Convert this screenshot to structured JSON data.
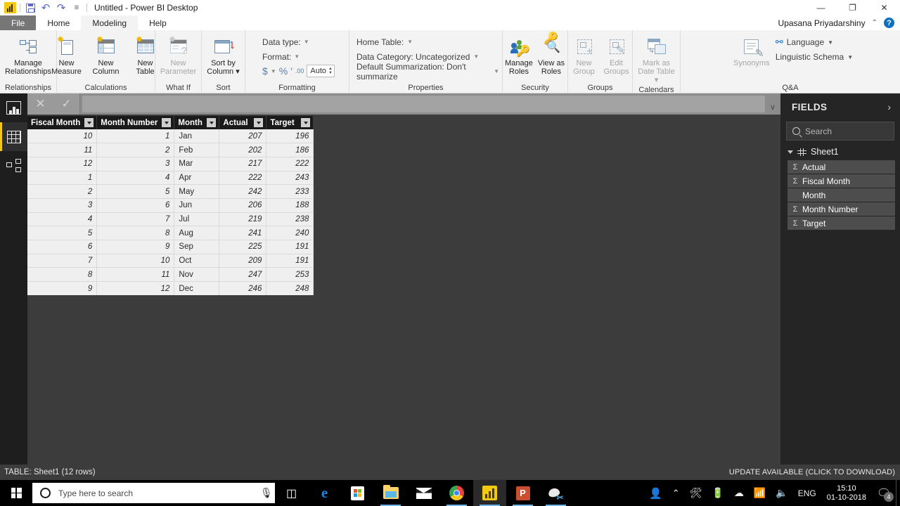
{
  "titlebar": {
    "app_icon": "power-bi-logo",
    "quick_access": [
      {
        "name": "save-icon",
        "label": "Save"
      },
      {
        "name": "undo-icon",
        "label": "↶"
      },
      {
        "name": "redo-icon",
        "label": "↷"
      },
      {
        "name": "customize-qat-icon",
        "label": "⨍"
      }
    ],
    "title": "Untitled - Power BI Desktop",
    "minimize": "—",
    "restore": "❐",
    "close": "✕"
  },
  "tabs": {
    "items": [
      {
        "label": "File",
        "kind": "file"
      },
      {
        "label": "Home",
        "kind": "normal"
      },
      {
        "label": "Modeling",
        "kind": "active"
      },
      {
        "label": "Help",
        "kind": "normal"
      }
    ],
    "user": "Upasana Priyadarshiny",
    "collapse_icon": "⌃",
    "help_icon": "?"
  },
  "ribbon": {
    "groups": [
      {
        "name": "Relationships",
        "buttons": [
          {
            "label": "Manage\nRelationships",
            "icon": "manage-relationships-icon",
            "disabled": false
          }
        ]
      },
      {
        "name": "Calculations",
        "buttons": [
          {
            "label": "New\nMeasure",
            "icon": "new-measure-icon",
            "disabled": false
          },
          {
            "label": "New\nColumn",
            "icon": "new-column-icon",
            "disabled": false
          },
          {
            "label": "New\nTable",
            "icon": "new-table-icon",
            "disabled": false
          }
        ]
      },
      {
        "name": "What If",
        "buttons": [
          {
            "label": "New\nParameter",
            "icon": "new-parameter-icon",
            "disabled": true
          }
        ]
      },
      {
        "name": "Sort",
        "buttons": [
          {
            "label": "Sort by\nColumn ▾",
            "icon": "sort-by-column-icon",
            "disabled": false
          }
        ]
      }
    ],
    "formatting": {
      "group_name": "Formatting",
      "data_type_label": "Data type:",
      "format_label": "Format:",
      "currency_icon": "$",
      "percent_icon": "%",
      "thousands_icon": "′",
      "decimal_icon": ".00",
      "auto_value": "Auto"
    },
    "properties": {
      "group_name": "Properties",
      "home_table_label": "Home Table:",
      "data_category_label": "Data Category: Uncategorized",
      "default_summarization_label": "Default Summarization: Don't summarize"
    },
    "security": {
      "group_name": "Security",
      "buttons": [
        {
          "label": "Manage\nRoles",
          "icon": "manage-roles-icon"
        },
        {
          "label": "View as\nRoles",
          "icon": "view-as-roles-icon"
        }
      ]
    },
    "groups_section": {
      "group_name": "Groups",
      "buttons": [
        {
          "label": "New\nGroup",
          "icon": "new-group-icon"
        },
        {
          "label": "Edit\nGroups",
          "icon": "edit-groups-icon"
        }
      ]
    },
    "calendars": {
      "group_name": "Calendars",
      "buttons": [
        {
          "label": "Mark as\nDate Table ▾",
          "icon": "mark-as-date-table-icon"
        }
      ]
    },
    "qa": {
      "group_name": "Q&A",
      "synonyms_label": "Synonyms",
      "synonyms_icon": "synonyms-icon",
      "language_label": "Language",
      "language_icon": "language-globe-icon",
      "linguistic_schema_label": "Linguistic Schema"
    }
  },
  "leftnav": {
    "items": [
      {
        "name": "report-view",
        "icon": "report-view-icon",
        "selected": false
      },
      {
        "name": "data-view",
        "icon": "data-view-icon",
        "selected": true
      },
      {
        "name": "model-view",
        "icon": "model-view-icon",
        "selected": false
      }
    ]
  },
  "formulabar": {
    "cancel_icon": "✕",
    "accept_icon": "✓",
    "value": "",
    "expand_icon": "∨"
  },
  "table": {
    "columns": [
      "Fiscal Month",
      "Month Number",
      "Month",
      "Actual",
      "Target"
    ],
    "filter_icon": "filter-dropdown-icon",
    "rows": [
      [
        "10",
        "1",
        "Jan",
        "207",
        "196"
      ],
      [
        "11",
        "2",
        "Feb",
        "202",
        "186"
      ],
      [
        "12",
        "3",
        "Mar",
        "217",
        "222"
      ],
      [
        "1",
        "4",
        "Apr",
        "222",
        "243"
      ],
      [
        "2",
        "5",
        "May",
        "242",
        "233"
      ],
      [
        "3",
        "6",
        "Jun",
        "206",
        "188"
      ],
      [
        "4",
        "7",
        "Jul",
        "219",
        "238"
      ],
      [
        "5",
        "8",
        "Aug",
        "241",
        "240"
      ],
      [
        "6",
        "9",
        "Sep",
        "225",
        "191"
      ],
      [
        "7",
        "10",
        "Oct",
        "209",
        "191"
      ],
      [
        "8",
        "11",
        "Nov",
        "247",
        "253"
      ],
      [
        "9",
        "12",
        "Dec",
        "246",
        "248"
      ]
    ]
  },
  "fields": {
    "title": "FIELDS",
    "collapse_icon": "›",
    "search_placeholder": "Search",
    "search_value": "",
    "table_name": "Sheet1",
    "items": [
      {
        "label": "Actual",
        "aggregate": true
      },
      {
        "label": "Fiscal Month",
        "aggregate": true
      },
      {
        "label": "Month",
        "aggregate": false
      },
      {
        "label": "Month Number",
        "aggregate": true
      },
      {
        "label": "Target",
        "aggregate": true
      }
    ],
    "sigma_glyph": "Σ"
  },
  "statusbar": {
    "left": "TABLE: Sheet1 (12 rows)",
    "right": "UPDATE AVAILABLE (CLICK TO DOWNLOAD)"
  },
  "taskbar": {
    "start_icon": "windows-start-icon",
    "search_placeholder": "Type here to search",
    "cortana_icon": "cortana-icon",
    "mic_icon": "ƪ",
    "taskview_icon": "task-view-icon",
    "apps": [
      {
        "name": "edge",
        "active": false,
        "running": false
      },
      {
        "name": "microsoft-store",
        "active": false,
        "running": false
      },
      {
        "name": "file-explorer",
        "active": false,
        "running": true
      },
      {
        "name": "mail",
        "active": false,
        "running": false
      },
      {
        "name": "google-chrome",
        "active": false,
        "running": true
      },
      {
        "name": "power-bi-desktop",
        "active": true,
        "running": true
      },
      {
        "name": "powerpoint",
        "active": false,
        "running": true
      },
      {
        "name": "snipping-tool",
        "active": false,
        "running": true
      }
    ],
    "tray": {
      "people_icon": "ᵔ",
      "chevron_icon": "⌃",
      "settings_icon": "☰",
      "battery_icon": "▭",
      "onedrive_icon": "☁",
      "wifi_icon": "◠",
      "volume_icon": "◂",
      "language": "ENG",
      "time": "15:10",
      "date": "01-10-2018",
      "action_center_icon": "▤",
      "notification_count": "4"
    }
  },
  "colors": {
    "accent_yellow": "#f2c811",
    "ribbon_bg": "#f3f3f3",
    "workspace_bg": "#3c3c3c",
    "fields_bg": "#252525",
    "header_row_bg": "#1a1a1a",
    "data_row_bg": "#efefef"
  }
}
